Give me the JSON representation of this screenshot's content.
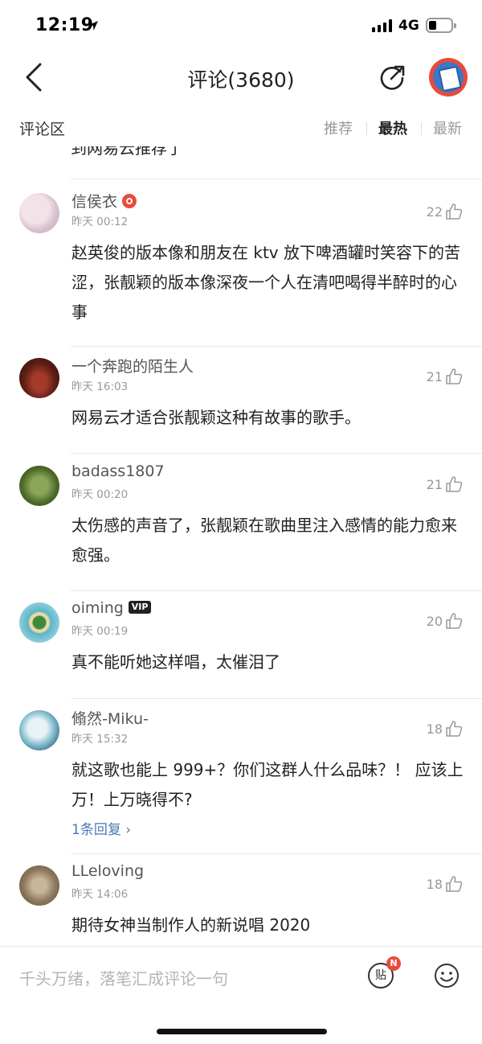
{
  "status": {
    "time": "12:19",
    "network": "4G"
  },
  "header": {
    "title": "评论(3680)"
  },
  "section": {
    "label": "评论区",
    "tabs": [
      {
        "label": "推荐",
        "active": false
      },
      {
        "label": "最热",
        "active": true
      },
      {
        "label": "最新",
        "active": false
      }
    ]
  },
  "partial_text": "到网易云推荐了",
  "comments": [
    {
      "user": "信侯衣",
      "badge": "red",
      "time": "昨天 00:12",
      "likes": "22",
      "text": "赵英俊的版本像和朋友在 ktv 放下啤酒罐时笑容下的苦涩，张靓颖的版本像深夜一个人在清吧喝得半醉时的心事",
      "replies": ""
    },
    {
      "user": "一个奔跑的陌生人",
      "badge": "",
      "time": "昨天 16:03",
      "likes": "21",
      "text": "网易云才适合张靓颖这种有故事的歌手。",
      "replies": ""
    },
    {
      "user": "badass1807",
      "badge": "",
      "time": "昨天 00:20",
      "likes": "21",
      "text": "太伤感的声音了，张靓颖在歌曲里注入感情的能力愈来愈强。",
      "replies": ""
    },
    {
      "user": "oiming",
      "badge": "vip",
      "vip_label": "VIP",
      "time": "昨天 00:19",
      "likes": "20",
      "text": "真不能听她这样唱，太催泪了",
      "replies": ""
    },
    {
      "user": "翛然-Miku-",
      "badge": "",
      "time": "昨天 15:32",
      "likes": "18",
      "text": "就这歌也能上 999+？你们这群人什么品味？！ 应该上万！上万晓得不?",
      "replies": "1条回复"
    },
    {
      "user": "LLeloving",
      "badge": "",
      "time": "昨天 14:06",
      "likes": "18",
      "text": "期待女神当制作人的新说唱 2020",
      "replies": ""
    }
  ],
  "bottom": {
    "placeholder": "千头万绪，落笔汇成评论一句",
    "tie_label": "贴",
    "tie_badge": "N"
  },
  "colors": {
    "accent_red": "#e84b3c",
    "link_blue": "#4a78b8"
  }
}
